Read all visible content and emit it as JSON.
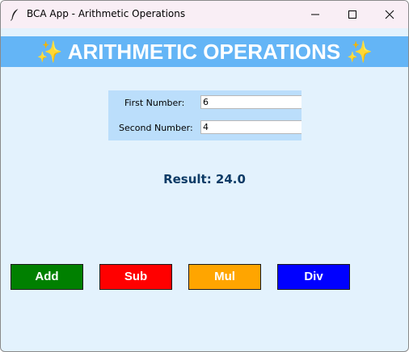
{
  "window": {
    "title": "BCA App - Arithmetic Operations",
    "icon": "feather-icon",
    "controls": {
      "minimize_icon": "minimize-icon",
      "maximize_icon": "maximize-icon",
      "close_icon": "close-icon"
    }
  },
  "header": {
    "title": "✨ ARITHMETIC OPERATIONS ✨",
    "background": "#64b5f6"
  },
  "form": {
    "first_label": "First Number:",
    "first_value": "6",
    "second_label": "Second Number:",
    "second_value": "4"
  },
  "result": {
    "text": "Result: 24.0"
  },
  "buttons": [
    {
      "label": "Add",
      "color": "#008000"
    },
    {
      "label": "Sub",
      "color": "#ff0000"
    },
    {
      "label": "Mul",
      "color": "#ffa500"
    },
    {
      "label": "Div",
      "color": "#0000ff"
    }
  ],
  "colors": {
    "background": "#e3f2fd",
    "form_panel": "#bbdefb",
    "result_text": "#0d3b66"
  }
}
